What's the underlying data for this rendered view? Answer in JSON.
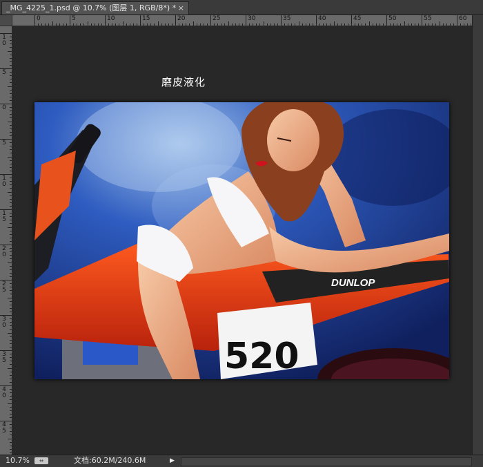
{
  "document_tab": {
    "title": "_MG_4225_1.psd @ 10.7% (图层 1, RGB/8*) *",
    "close_glyph": "×"
  },
  "ruler": {
    "top_labels": [
      "0",
      "5",
      "10",
      "15",
      "20",
      "25",
      "30",
      "35",
      "40",
      "45",
      "50",
      "55",
      "60"
    ],
    "left_labels": [
      "1\n0",
      "5",
      "0",
      "5",
      "1\n0",
      "1\n5",
      "2\n0",
      "2\n5",
      "3\n0",
      "3\n5",
      "4\n0",
      "4\n5"
    ]
  },
  "canvas": {
    "layer_text": "磨皮液化",
    "photo_subject": "woman-on-motorcycle-photo",
    "motorcycle_number": "520",
    "brand_text": "DUNLOP"
  },
  "status_bar": {
    "zoom": "10.7%",
    "doc_info": "文档:60.2M/240.6M",
    "arrow": "▶"
  },
  "colors": {
    "workspace_bg": "#282828",
    "ruler_bg": "#6a6a6a",
    "tab_bg": "#535353",
    "photo_blue": "#1a3b8f",
    "bike_red": "#e0401a"
  }
}
